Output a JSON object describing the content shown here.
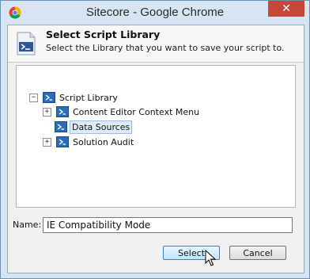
{
  "window": {
    "title": "Sitecore - Google Chrome",
    "close_label": "✕"
  },
  "header": {
    "title": "Select Script Library",
    "subtitle": "Select the Library that you want to save your script to."
  },
  "tree": {
    "root": {
      "label": "Script Library",
      "expander": "−"
    },
    "children": [
      {
        "label": "Content Editor Context Menu",
        "expander": "+"
      },
      {
        "label": "Data Sources",
        "expander": "",
        "selected": true
      },
      {
        "label": "Solution Audit",
        "expander": "+"
      }
    ]
  },
  "name_field": {
    "label": "Name:",
    "value": "IE Compatibility Mode"
  },
  "buttons": {
    "select": "Select",
    "cancel": "Cancel"
  },
  "colors": {
    "titlebar": "#d7e4f2",
    "close": "#c7463a",
    "selection": "#dfeaf7"
  }
}
